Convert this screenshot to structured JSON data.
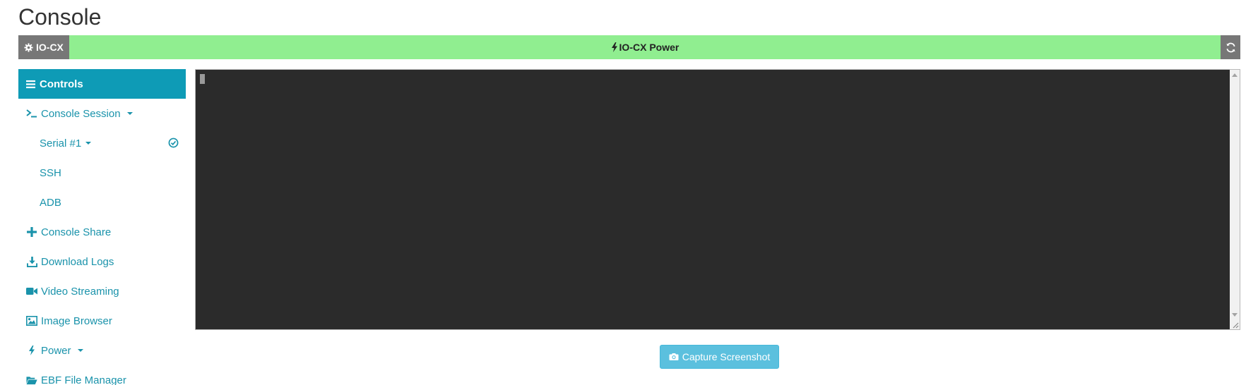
{
  "page": {
    "title": "Console"
  },
  "power_bar": {
    "device_label": "IO-CX",
    "power_label": "IO-CX Power",
    "bar_color": "#90ee90",
    "tag_color": "#777777"
  },
  "sidebar": {
    "header": "Controls",
    "header_color": "#0e9bb6",
    "link_color": "#1a93ab",
    "items": [
      {
        "label": "Console Session",
        "icon": "terminal-icon",
        "caret": true
      },
      {
        "label": "Serial #1",
        "caret": true,
        "active_icon": "check-circle-icon"
      },
      {
        "label": "SSH"
      },
      {
        "label": "ADB"
      },
      {
        "label": "Console Share",
        "icon": "plus-icon"
      },
      {
        "label": "Download Logs",
        "icon": "download-icon"
      },
      {
        "label": "Video Streaming",
        "icon": "video-camera-icon"
      },
      {
        "label": "Image Browser",
        "icon": "image-icon"
      },
      {
        "label": "Power",
        "icon": "bolt-icon",
        "caret": true
      },
      {
        "label": "EBF File Manager",
        "icon": "folder-open-icon"
      }
    ]
  },
  "terminal": {
    "background": "#2b2b2b"
  },
  "actions": {
    "capture_label": "Capture Screenshot",
    "capture_icon": "camera-icon"
  }
}
